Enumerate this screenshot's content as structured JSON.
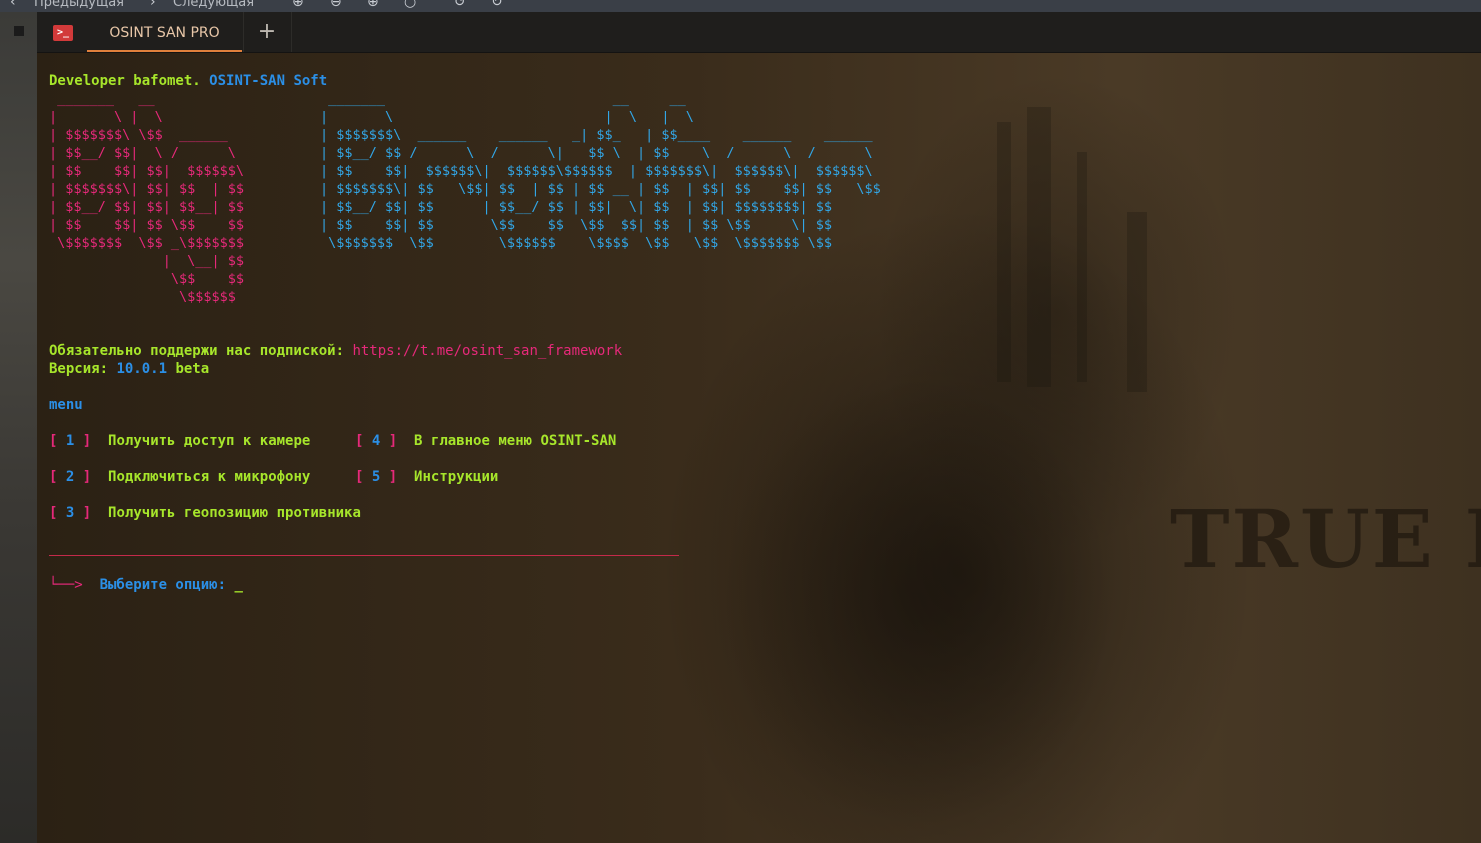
{
  "viewer": {
    "prev_label": "Предыдущая",
    "next_label": "Следующая"
  },
  "tab": {
    "title": "OSINT SAN PRO",
    "new_tab": "+"
  },
  "terminal": {
    "header_prefix": "Developer bafomet. ",
    "header_suffix": "OSINT-SAN Soft",
    "ascii_left": [
      " _______   __",
      "|       \\ |  \\",
      "| $$$$$$$\\ \\$$  ______",
      "| $$__/ $$|  \\ /      \\",
      "| $$    $$| $$|  $$$$$$\\",
      "| $$$$$$$\\| $$| $$  | $$",
      "| $$__/ $$| $$| $$__| $$",
      "| $$    $$| $$ \\$$    $$",
      " \\$$$$$$$  \\$$ _\\$$$$$$$",
      "              |  \\__| $$",
      "               \\$$    $$",
      "                \\$$$$$$"
    ],
    "ascii_right": [
      " _______                            __     __",
      "|       \\                          |  \\   |  \\",
      "| $$$$$$$\\  ______    ______   _| $$_   | $$____    ______    ______",
      "| $$__/ $$ /      \\  /      \\|   $$ \\  | $$    \\  /      \\  /      \\",
      "| $$    $$|  $$$$$$\\|  $$$$$$\\$$$$$$  | $$$$$$$\\|  $$$$$$\\|  $$$$$$\\",
      "| $$$$$$$\\| $$   \\$$| $$  | $$ | $$ __ | $$  | $$| $$    $$| $$   \\$$",
      "| $$__/ $$| $$      | $$__/ $$ | $$|  \\| $$  | $$| $$$$$$$$| $$",
      "| $$    $$| $$       \\$$    $$  \\$$  $$| $$  | $$ \\$$     \\| $$",
      " \\$$$$$$$  \\$$        \\$$$$$$    \\$$$$  \\$$   \\$$  \\$$$$$$$ \\$$"
    ],
    "support_label": "Обязательно поддержи нас подпиской",
    "support_colon": ": ",
    "support_link": "https://t.me/osint_san_framework",
    "version_label": "Версия: ",
    "version_number": "10.0.1",
    "version_suffix": " beta",
    "menu_title": "menu",
    "menu_items": [
      {
        "num": "1",
        "label": "Получить доступ к камере"
      },
      {
        "num": "2",
        "label": "Подключиться к микрофону"
      },
      {
        "num": "3",
        "label": "Получить геопозицию противника"
      },
      {
        "num": "4",
        "label": "В главное меню OSINT-SAN"
      },
      {
        "num": "5",
        "label": "Инструкции"
      }
    ],
    "prompt_arrow": "└──>",
    "prompt_label": "Выберите опцию:",
    "cursor": "_",
    "bracket_open": "[",
    "bracket_close": "]"
  },
  "background_text": "TRUE DE",
  "colors": {
    "accent_green": "#a7e62b",
    "accent_blue": "#2b8fe6",
    "accent_pink": "#e6297a",
    "tab_underline": "#e0803c"
  }
}
